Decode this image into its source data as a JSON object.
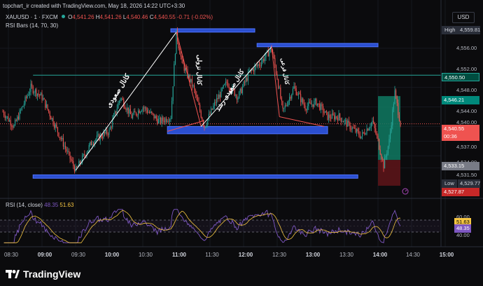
{
  "header": {
    "attribution": "topchart_ir created with TradingView.com, May 18, 2026 14:22 UTC+3:30",
    "symbol": "XAUUSD · 1 · FXCM",
    "ohlc": {
      "o_label": "O",
      "o_value": "4,541.26",
      "h_label": "H",
      "h_value": "4,541.26",
      "l_label": "L",
      "l_value": "4,540.46",
      "c_label": "C",
      "c_value": "4,540.55",
      "change": "-0.71 (-0.02%)"
    },
    "indicator": "RSI Bars (14, 70, 30)",
    "currency_button": "USD"
  },
  "price_axis": {
    "ticks": [
      "4,556.00",
      "4,552.00",
      "4,548.00",
      "4,544.00",
      "4,540.00",
      "4,537.00",
      "4,534.00",
      "4,531.50",
      "4,527.00"
    ],
    "tags": {
      "high_label": "High",
      "high_value": "4,559.81",
      "level_value": "4,550.50",
      "target_value": "4,546.21",
      "current_value": "4,540.55",
      "countdown": "00:36",
      "entry_value": "4,533.15",
      "low_label": "Low",
      "low_value": "4,529.77",
      "stop_value": "4,527.87"
    }
  },
  "time_axis": {
    "labels": [
      "08:30",
      "09:00",
      "09:30",
      "10:00",
      "10:30",
      "11:00",
      "11:30",
      "12:00",
      "12:30",
      "13:00",
      "13:30",
      "14:00",
      "14:30",
      "15:00"
    ]
  },
  "annotations": {
    "text1": "کانال صعودی",
    "text2": "کانال نزولی",
    "text3": "کانال صعودی رشد",
    "text4": "کانال فرعی"
  },
  "rsi_panel": {
    "label": "RSI (14, close)",
    "value1": "48.35",
    "value2": "51.63",
    "levels": [
      "60.00",
      "40.00"
    ],
    "tags": [
      "51.63",
      "48.35"
    ]
  },
  "footer": {
    "brand": "TradingView"
  },
  "colors": {
    "background": "#0b0b0d",
    "up": "#26a69a",
    "down": "#ef5350",
    "zone": "#2b4fd0",
    "level_line": "#26a69a",
    "rsi_line": "#7e57c2",
    "rsi_ma": "#f5c542",
    "target_box": "#0f7a63",
    "stop_box": "#5a1418"
  },
  "chart_data": {
    "type": "candlestick",
    "symbol": "XAUUSD",
    "timeframe": "1",
    "x_range": [
      "08:25",
      "15:00"
    ],
    "y_range": [
      4526,
      4561
    ],
    "anchors": [
      {
        "t": "08:25",
        "p": 4543
      },
      {
        "t": "08:35",
        "p": 4540
      },
      {
        "t": "08:50",
        "p": 4548
      },
      {
        "t": "09:00",
        "p": 4546
      },
      {
        "t": "09:10",
        "p": 4541
      },
      {
        "t": "09:20",
        "p": 4536
      },
      {
        "t": "09:30",
        "p": 4531
      },
      {
        "t": "09:45",
        "p": 4537
      },
      {
        "t": "10:00",
        "p": 4539
      },
      {
        "t": "10:10",
        "p": 4546
      },
      {
        "t": "10:20",
        "p": 4542
      },
      {
        "t": "10:30",
        "p": 4544
      },
      {
        "t": "10:45",
        "p": 4541
      },
      {
        "t": "10:55",
        "p": 4542
      },
      {
        "t": "11:00",
        "p": 4559
      },
      {
        "t": "11:05",
        "p": 4553
      },
      {
        "t": "11:15",
        "p": 4548
      },
      {
        "t": "11:25",
        "p": 4540
      },
      {
        "t": "11:35",
        "p": 4545
      },
      {
        "t": "11:45",
        "p": 4549
      },
      {
        "t": "11:55",
        "p": 4546
      },
      {
        "t": "12:05",
        "p": 4551
      },
      {
        "t": "12:15",
        "p": 4553
      },
      {
        "t": "12:25",
        "p": 4556
      },
      {
        "t": "12:30",
        "p": 4550
      },
      {
        "t": "12:35",
        "p": 4543
      },
      {
        "t": "12:45",
        "p": 4548
      },
      {
        "t": "12:55",
        "p": 4544
      },
      {
        "t": "13:05",
        "p": 4545
      },
      {
        "t": "13:15",
        "p": 4542
      },
      {
        "t": "13:25",
        "p": 4542
      },
      {
        "t": "13:35",
        "p": 4540
      },
      {
        "t": "13:45",
        "p": 4538
      },
      {
        "t": "13:55",
        "p": 4541
      },
      {
        "t": "14:00",
        "p": 4537
      },
      {
        "t": "14:05",
        "p": 4532
      },
      {
        "t": "14:10",
        "p": 4537
      },
      {
        "t": "14:15",
        "p": 4547
      },
      {
        "t": "14:20",
        "p": 4540.55
      }
    ],
    "levels": {
      "high": 4559.81,
      "horizontal": 4550.5,
      "target": 4546.21,
      "current": 4540.55,
      "entry": 4533.15,
      "low": 4529.77,
      "stop": 4527.87
    },
    "zones": [
      {
        "from": "10:55",
        "to": "12:10",
        "y_top": 4560,
        "y_bottom": 4559.3
      },
      {
        "from": "12:12",
        "to": "14:00",
        "y_top": 4557,
        "y_bottom": 4556.3
      },
      {
        "from": "10:52",
        "to": "13:15",
        "y_top": 4540,
        "y_bottom": 4538.5
      },
      {
        "from": "08:52",
        "to": "13:42",
        "y_top": 4530.1,
        "y_bottom": 4529.4
      }
    ],
    "trendlines": [
      {
        "from": {
          "t": "09:30",
          "p": 4531
        },
        "to": {
          "t": "11:00",
          "p": 4559.3
        }
      },
      {
        "from": {
          "t": "11:00",
          "p": 4559.3
        },
        "to": {
          "t": "11:22",
          "p": 4540
        }
      },
      {
        "from": {
          "t": "11:22",
          "p": 4540
        },
        "to": {
          "t": "12:25",
          "p": 4556.3
        }
      },
      {
        "from": {
          "t": "12:25",
          "p": 4556.3
        },
        "to": {
          "t": "12:32",
          "p": 4542
        }
      },
      {
        "from": {
          "t": "12:32",
          "p": 4542
        },
        "to": {
          "t": "13:12",
          "p": 4540
        }
      },
      {
        "from": {
          "t": "10:52",
          "p": 4539
        },
        "to": {
          "t": "11:25",
          "p": 4541.2
        }
      }
    ],
    "position": {
      "start": "14:00",
      "end": "14:20",
      "entry": 4533.15,
      "target": 4546.21,
      "stop": 4527.87
    },
    "rsi": {
      "period": 14,
      "levels": [
        60,
        40
      ],
      "last": 48.35,
      "ma_last": 51.63
    }
  }
}
